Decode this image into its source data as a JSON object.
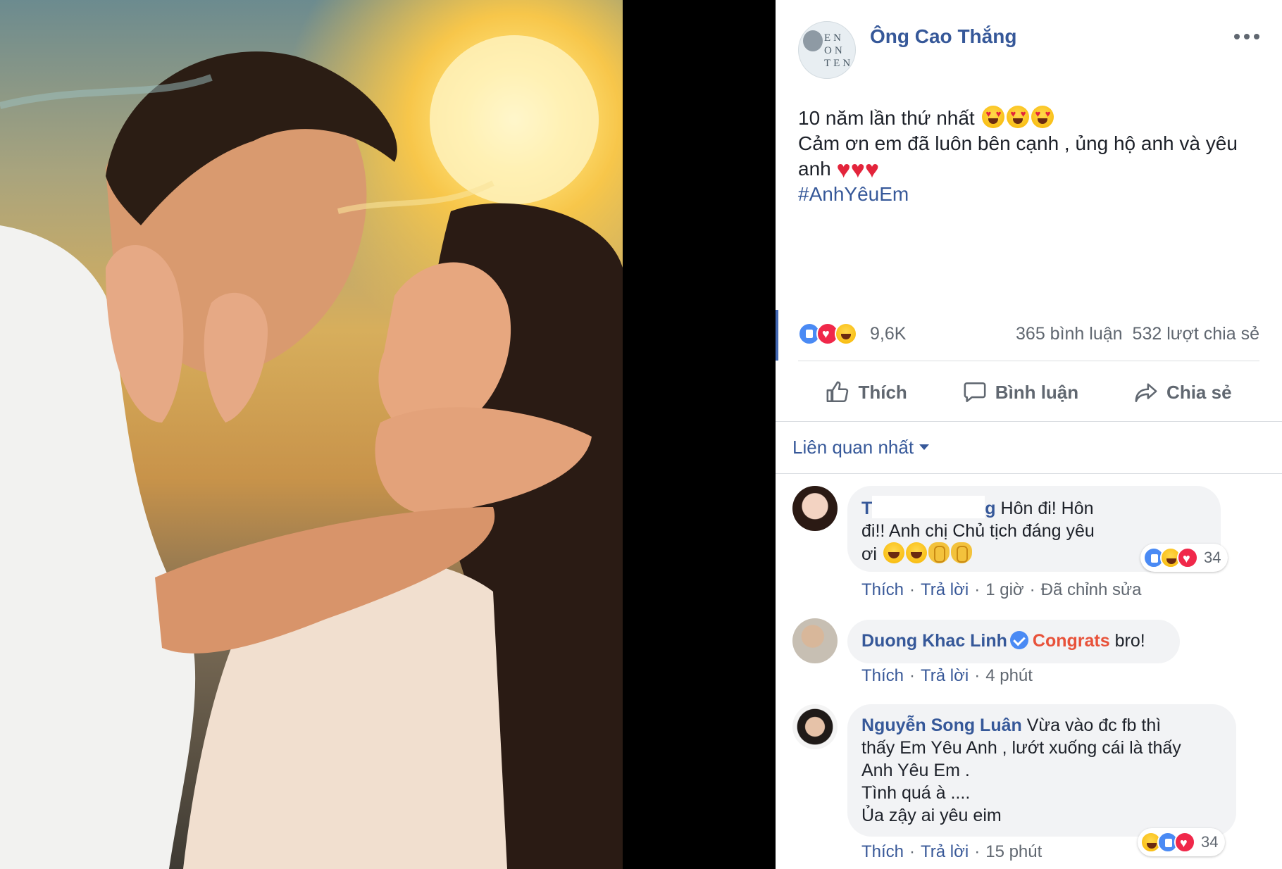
{
  "post": {
    "author": "Ông Cao Thắng",
    "avatar_logo_text": "EN\nON\nTEN",
    "line1": "10 năm lần thứ nhất",
    "line2": "Cảm ơn em đã luôn bên cạnh , ủng hộ anh và yêu anh",
    "hashtag": "#AnhYêuEm",
    "emoji_line1": [
      "smiling-face-with-heart-eyes",
      "smiling-face-with-heart-eyes",
      "smiling-face-with-heart-eyes"
    ],
    "emoji_line2": [
      "red-heart",
      "red-heart",
      "red-heart"
    ]
  },
  "stats": {
    "reaction_types": [
      "like",
      "love",
      "haha"
    ],
    "reaction_count": "9,6K",
    "comments": "365 bình luận",
    "shares": "532 lượt chia sẻ"
  },
  "actions": {
    "like": "Thích",
    "comment": "Bình luận",
    "share": "Chia sẻ"
  },
  "sort": {
    "label": "Liên quan nhất"
  },
  "comments": [
    {
      "name_initial": "T",
      "name_suffix": "g",
      "text_line1": "Hôn đi! Hôn",
      "text_line2": "đi!! Anh chị Chủ tịch đáng yêu",
      "text_line3": "ơi",
      "emojis": [
        "face-with-tears-of-joy",
        "face-with-tears-of-joy",
        "clapping-hands",
        "clapping-hands"
      ],
      "reaction_count": "34",
      "like": "Thích",
      "reply": "Trả lời",
      "time": "1 giờ",
      "edited": "Đã chỉnh sửa"
    },
    {
      "name": "Duong Khac Linh",
      "highlight": "Congrats",
      "text": "bro!",
      "like": "Thích",
      "reply": "Trả lời",
      "time": "4 phút"
    },
    {
      "name": "Nguyễn Song Luân",
      "text_line1": "Vừa vào đc fb thì",
      "text_line2": "thấy Em Yêu Anh , lướt xuống cái là thấy",
      "text_line3": "Anh Yêu Em .",
      "text_line4": "Tình quá à ....",
      "text_line5": "Ủa zậy ai yêu eim",
      "reaction_count": "34",
      "like": "Thích",
      "reply": "Trả lời",
      "time": "15 phút"
    }
  ],
  "colors": {
    "link_blue": "#365899",
    "text": "#1d2129",
    "meta_gray": "#606770",
    "bubble_bg": "#f2f3f5",
    "congrats_orange": "#e8523a"
  }
}
